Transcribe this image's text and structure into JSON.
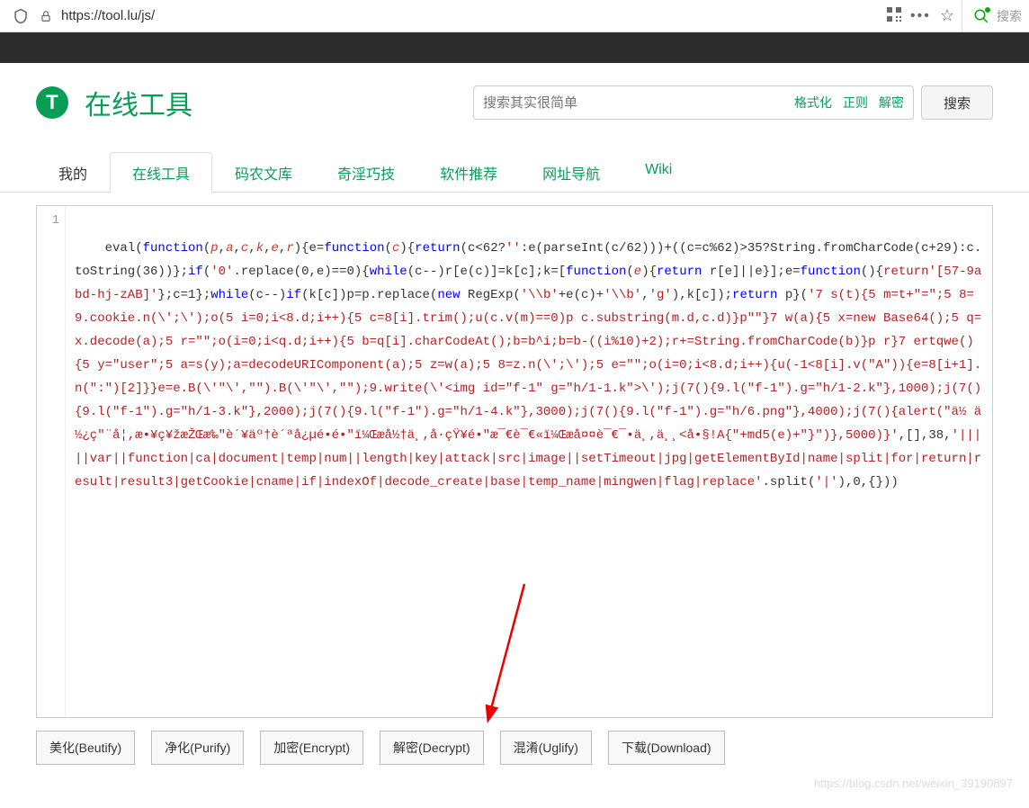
{
  "browser": {
    "url": "https://tool.lu/js/",
    "search_placeholder": "搜索"
  },
  "site": {
    "title": "在线工具",
    "logo_letter": "T"
  },
  "search": {
    "placeholder": "搜索其实很简单",
    "tags": [
      "格式化",
      "正则",
      "解密"
    ],
    "button": "搜索"
  },
  "nav": {
    "tabs": [
      {
        "label": "我的",
        "active": false,
        "green": false
      },
      {
        "label": "在线工具",
        "active": true,
        "green": true
      },
      {
        "label": "码农文库",
        "active": false,
        "green": true
      },
      {
        "label": "奇淫巧技",
        "active": false,
        "green": true
      },
      {
        "label": "软件推荐",
        "active": false,
        "green": true
      },
      {
        "label": "网址导航",
        "active": false,
        "green": true
      },
      {
        "label": "Wiki",
        "active": false,
        "green": true
      }
    ]
  },
  "editor": {
    "line_number": "1",
    "code_tokens": [
      {
        "t": "eval",
        "c": "plain"
      },
      {
        "t": "(",
        "c": "plain"
      },
      {
        "t": "function",
        "c": "kw"
      },
      {
        "t": "(",
        "c": "plain"
      },
      {
        "t": "p",
        "c": "var"
      },
      {
        "t": ",",
        "c": "plain"
      },
      {
        "t": "a",
        "c": "var"
      },
      {
        "t": ",",
        "c": "plain"
      },
      {
        "t": "c",
        "c": "var"
      },
      {
        "t": ",",
        "c": "plain"
      },
      {
        "t": "k",
        "c": "var"
      },
      {
        "t": ",",
        "c": "plain"
      },
      {
        "t": "e",
        "c": "var"
      },
      {
        "t": ",",
        "c": "plain"
      },
      {
        "t": "r",
        "c": "var"
      },
      {
        "t": "){e=",
        "c": "plain"
      },
      {
        "t": "function",
        "c": "kw"
      },
      {
        "t": "(",
        "c": "plain"
      },
      {
        "t": "c",
        "c": "var"
      },
      {
        "t": "){",
        "c": "plain"
      },
      {
        "t": "return",
        "c": "kw"
      },
      {
        "t": "(c<62?",
        "c": "plain"
      },
      {
        "t": "''",
        "c": "str"
      },
      {
        "t": ":e(parseInt(c/62)))+((c=c%62)>35?String.fromCharCode(c+29):c.toString(36))};",
        "c": "plain"
      },
      {
        "t": "if",
        "c": "kw"
      },
      {
        "t": "(",
        "c": "plain"
      },
      {
        "t": "'0'",
        "c": "str"
      },
      {
        "t": ".replace(0,e)==0){",
        "c": "plain"
      },
      {
        "t": "while",
        "c": "kw"
      },
      {
        "t": "(c--)r[e(c)]=k[c];k=[",
        "c": "plain"
      },
      {
        "t": "function",
        "c": "kw"
      },
      {
        "t": "(",
        "c": "plain"
      },
      {
        "t": "e",
        "c": "var"
      },
      {
        "t": "){",
        "c": "plain"
      },
      {
        "t": "return",
        "c": "kw"
      },
      {
        "t": " r[e]||e}];e=",
        "c": "plain"
      },
      {
        "t": "function",
        "c": "kw"
      },
      {
        "t": "(){",
        "c": "plain"
      },
      {
        "t": "return'[57-9abd-hj-zAB]'",
        "c": "str"
      },
      {
        "t": "};c=1};",
        "c": "plain"
      },
      {
        "t": "while",
        "c": "kw"
      },
      {
        "t": "(c--)",
        "c": "plain"
      },
      {
        "t": "if",
        "c": "kw"
      },
      {
        "t": "(k[c])p=p.replace(",
        "c": "plain"
      },
      {
        "t": "new",
        "c": "kw"
      },
      {
        "t": " RegExp(",
        "c": "plain"
      },
      {
        "t": "'\\\\b'",
        "c": "str"
      },
      {
        "t": "+e(c)+",
        "c": "plain"
      },
      {
        "t": "'\\\\b'",
        "c": "str"
      },
      {
        "t": ",",
        "c": "plain"
      },
      {
        "t": "'g'",
        "c": "str"
      },
      {
        "t": "),k[c]);",
        "c": "plain"
      },
      {
        "t": "return",
        "c": "kw"
      },
      {
        "t": " p}(",
        "c": "plain"
      },
      {
        "t": "'7 s(t){5 m=t+\"=\";5 8=9.cookie.n(\\';\\');o(5 i=0;i<8.d;i++){5 c=8[i].trim();u(c.v(m)==0)p c.substring(m.d,c.d)}p\"\"}7 w(a){5 x=new Base64();5 q=x.decode(a);5 r=\"\";o(i=0;i<q.d;i++){5 b=q[i].charCodeAt();b=b^i;b=b-((i%10)+2);r+=String.fromCharCode(b)}p r}7 ertqwe(){5 y=\"user\";5 a=s(y);a=decodeURIComponent(a);5 z=w(a);5 8=z.n(\\';\\');5 e=\"\";o(i=0;i<8.d;i++){u(-1<8[i].v(\"A\")){e=8[i+1].n(\":\")[2]}}e=e.B(\\'\"\\',\"\").B(\\'\"\\',\"\");9.write(\\'<img id=\"f-1\" g=\"h/1-1.k\">\\');j(7(){9.l(\"f-1\").g=\"h/1-2.k\"},1000);j(7(){9.l(\"f-1\").g=\"h/1-3.k\"},2000);j(7(){9.l(\"f-1\").g=\"h/1-4.k\"},3000);j(7(){9.l(\"f-1\").g=\"h/6.png\"},4000);j(7(){alert(\"ä½ ä½¿ç\"¨å¦,æ•¥ç¥žæŽŒæ‰\"è´¥äº†è´ªå¿µé•é•\"ï¼Œæ­å½†ä¸,å·çŸ¥é•\"æ¯€è¯€«ï¼Œæ­å¤¤è¯€¯•ä¸,ä¸¸<å•§!A{\"+md5(e)+\"}\")},5000)}'",
        "c": "str"
      },
      {
        "t": ",[],38,",
        "c": "plain"
      },
      {
        "t": "'|||||var||function|ca|document|temp|num||length|key|attack|src|image||setTimeout|jpg|getElementById|name|split|for|return|result|result3|getCookie|cname|if|indexOf|decode_create|base|temp_name|mingwen|flag|replace'",
        "c": "str"
      },
      {
        "t": ".split(",
        "c": "plain"
      },
      {
        "t": "'|'",
        "c": "str"
      },
      {
        "t": "),0,{}))",
        "c": "plain"
      }
    ]
  },
  "buttons": [
    {
      "label": "美化(Beutify)"
    },
    {
      "label": "净化(Purify)"
    },
    {
      "label": "加密(Encrypt)"
    },
    {
      "label": "解密(Decrypt)"
    },
    {
      "label": "混淆(Uglify)"
    },
    {
      "label": "下载(Download)"
    }
  ],
  "watermark": "https://blog.csdn.net/weixin_39190897"
}
